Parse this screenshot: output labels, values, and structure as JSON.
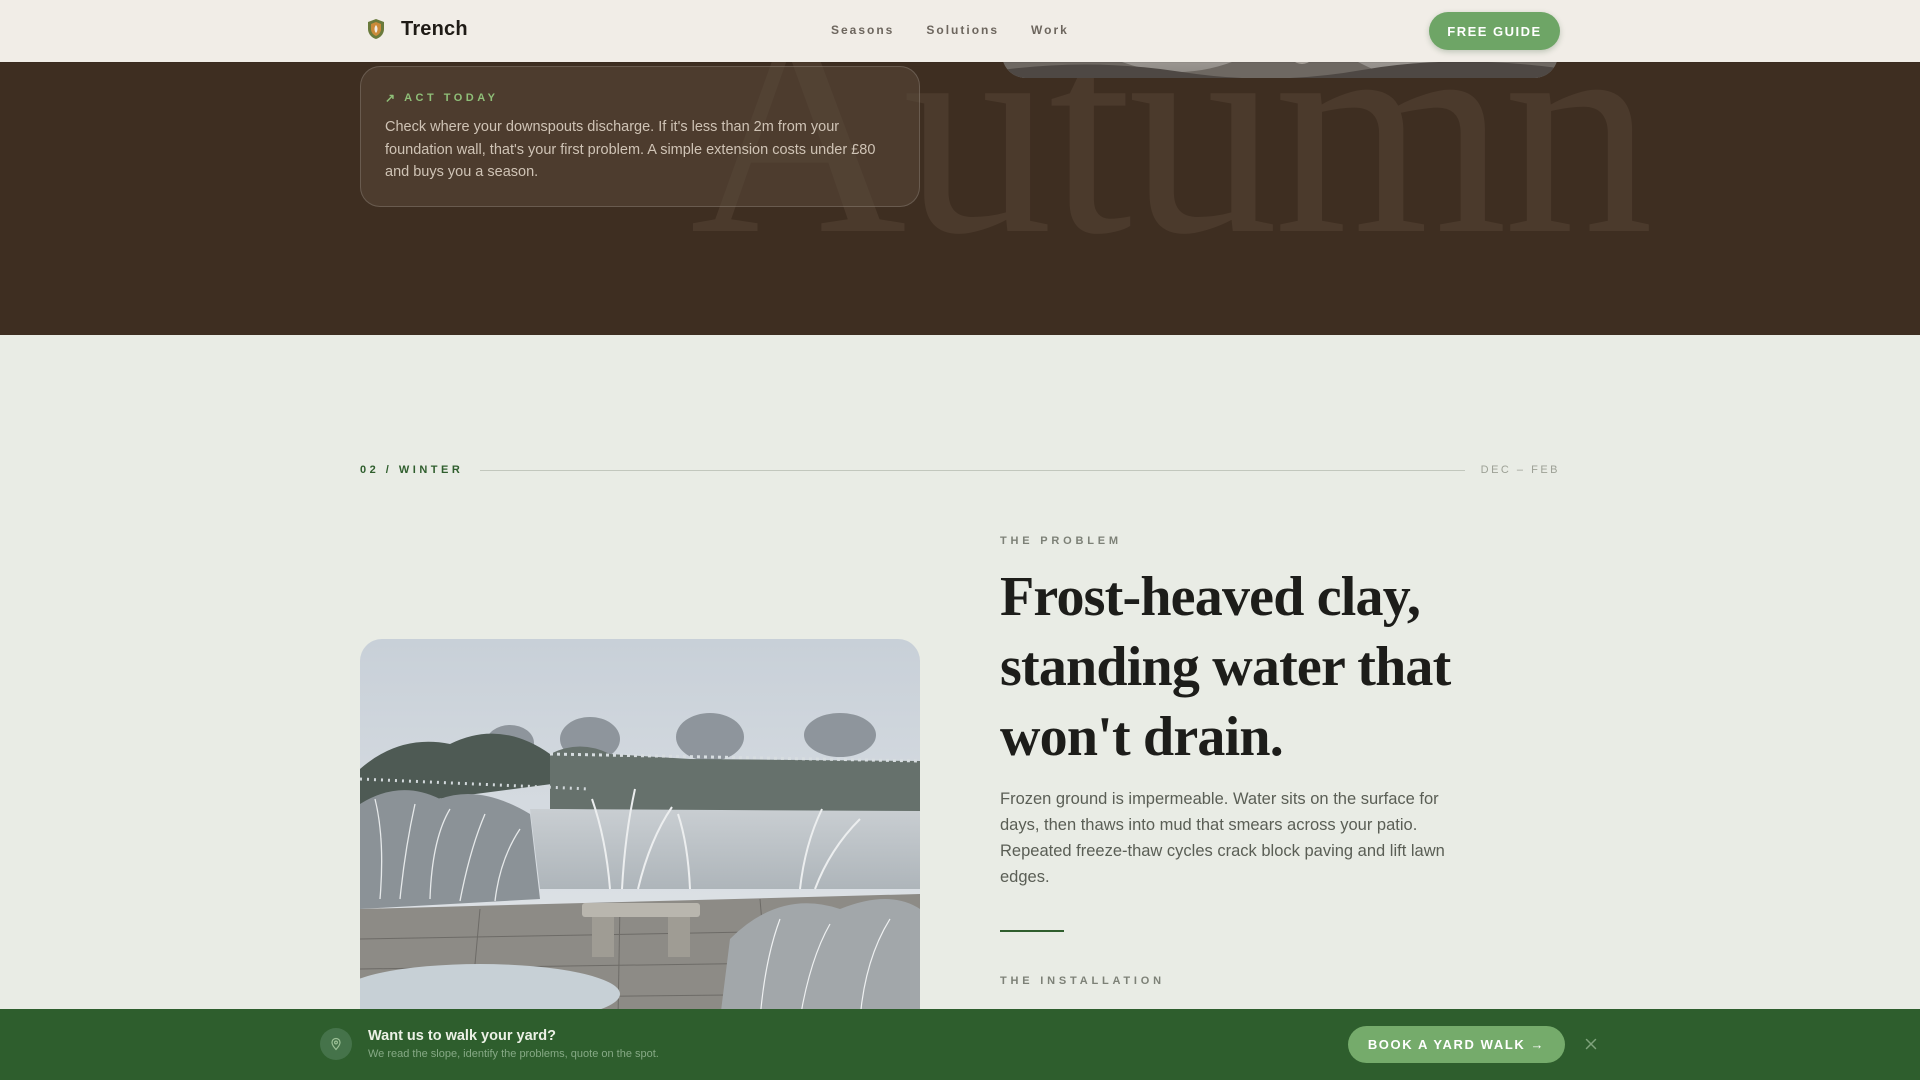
{
  "header": {
    "brand": "Trench",
    "nav": [
      "Seasons",
      "Solutions",
      "Work"
    ],
    "cta": "FREE GUIDE"
  },
  "autumn": {
    "ghost_word": "Autumn",
    "act_label": "ACT TODAY",
    "act_text": "Check where your downspouts discharge. If it's less than 2m from your foundation wall, that's your first problem. A simple extension costs under £80 and buys you a season."
  },
  "winter": {
    "section_label": "02 / WINTER",
    "date_range": "DEC – FEB",
    "problem_kicker": "THE PROBLEM",
    "headline": "Frost-heaved clay, standing water that won't drain.",
    "body": "Frozen ground is impermeable. Water sits on the surface for days, then thaws into mud that smears across your patio. Repeated freeze-thaw cycles crack block paving and lift lawn edges.",
    "installation_kicker": "THE INSTALLATION"
  },
  "sticky_bar": {
    "title": "Want us to walk your yard?",
    "subtitle": "We read the slope, identify the problems, quote on the spot.",
    "button": "BOOK A YARD WALK →"
  },
  "icons": {
    "brand": "shield-leaf-icon",
    "act": "arrow-up-right-icon",
    "pin": "map-pin-icon",
    "close": "close-icon"
  },
  "colors": {
    "brand_green": "#2e5e2d",
    "accent_green": "#6ea566",
    "autumn_brown": "#3e2e21",
    "page_bg": "#e9ece5"
  }
}
